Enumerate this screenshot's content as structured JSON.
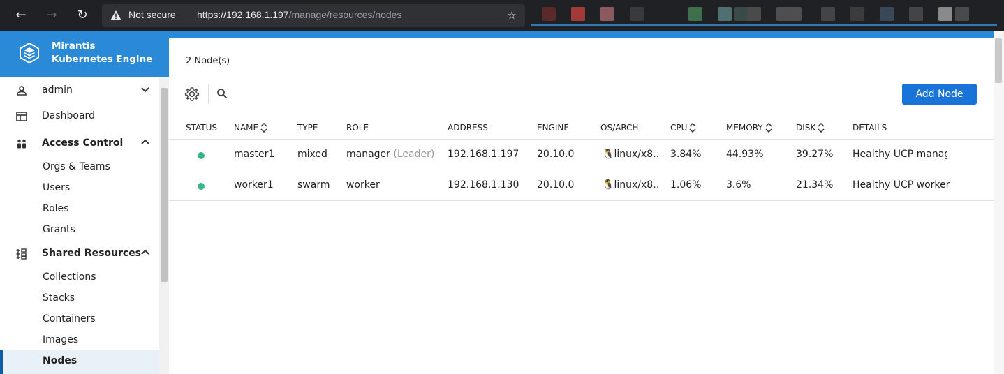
{
  "browser": {
    "security_label": "Not secure",
    "url_scheme": "https",
    "url_host": "://192.168.1.197",
    "url_path": "/manage/resources/nodes"
  },
  "brand": {
    "line1": "Mirantis",
    "line2": "Kubernetes Engine"
  },
  "sidebar": {
    "user": "admin",
    "dashboard": "Dashboard",
    "access_control": {
      "label": "Access Control",
      "items": [
        "Orgs & Teams",
        "Users",
        "Roles",
        "Grants"
      ]
    },
    "shared_resources": {
      "label": "Shared Resources",
      "items": [
        "Collections",
        "Stacks",
        "Containers",
        "Images",
        "Nodes"
      ]
    },
    "active_item": "Nodes"
  },
  "main": {
    "node_count": "2 Node(s)",
    "add_button": "Add Node",
    "columns": {
      "status": "STATUS",
      "name": "NAME",
      "type": "TYPE",
      "role": "ROLE",
      "address": "ADDRESS",
      "engine": "ENGINE",
      "os_arch": "OS/ARCH",
      "cpu": "CPU",
      "memory": "MEMORY",
      "disk": "DISK",
      "details": "DETAILS"
    },
    "rows": [
      {
        "status_color": "#3bb58a",
        "name": "master1",
        "type": "mixed",
        "role": "manager",
        "role_note": "(Leader)",
        "address": "192.168.1.197",
        "engine": "20.10.0",
        "os_arch": "linux/x8…",
        "cpu": "3.84%",
        "memory": "44.93%",
        "disk": "39.27%",
        "details": "Healthy UCP manage"
      },
      {
        "status_color": "#3bb58a",
        "name": "worker1",
        "type": "swarm",
        "role": "worker",
        "role_note": "",
        "address": "192.168.1.130",
        "engine": "20.10.0",
        "os_arch": "linux/x8…",
        "cpu": "1.06%",
        "memory": "3.6%",
        "disk": "21.34%",
        "details": "Healthy UCP worker"
      }
    ]
  },
  "colors": {
    "brand_blue": "#2a8ad8",
    "button_blue": "#1874d8",
    "healthy_green": "#3bb58a"
  }
}
